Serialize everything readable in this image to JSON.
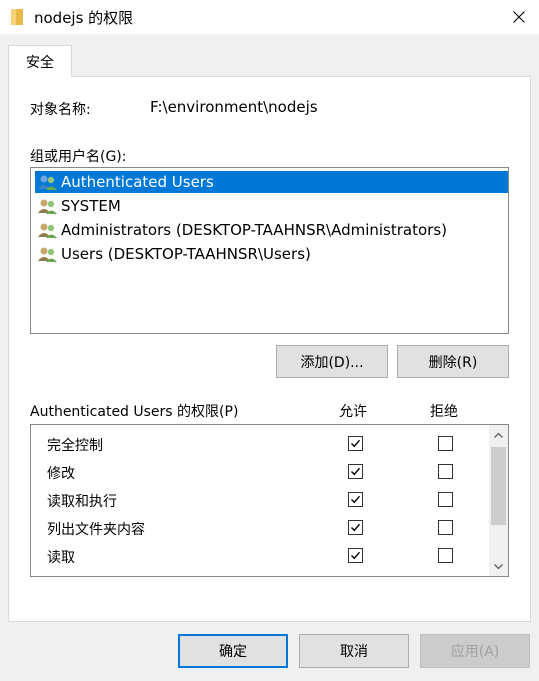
{
  "window": {
    "title": "nodejs 的权限",
    "close_icon": "close-icon"
  },
  "tab": {
    "label": "安全"
  },
  "object": {
    "label": "对象名称:",
    "value": "F:\\environment\\nodejs"
  },
  "groups": {
    "label": "组或用户名(G):",
    "items": [
      {
        "name": "Authenticated Users",
        "selected": true
      },
      {
        "name": "SYSTEM",
        "selected": false
      },
      {
        "name": "Administrators (DESKTOP-TAAHNSR\\Administrators)",
        "selected": false
      },
      {
        "name": "Users (DESKTOP-TAAHNSR\\Users)",
        "selected": false
      }
    ]
  },
  "buttons": {
    "add": "添加(D)...",
    "remove": "删除(R)",
    "ok": "确定",
    "cancel": "取消",
    "apply": "应用(A)"
  },
  "permissions": {
    "label": "Authenticated Users 的权限(P)",
    "allow_header": "允许",
    "deny_header": "拒绝",
    "rows": [
      {
        "name": "完全控制",
        "allow": true,
        "deny": false
      },
      {
        "name": "修改",
        "allow": true,
        "deny": false
      },
      {
        "name": "读取和执行",
        "allow": true,
        "deny": false
      },
      {
        "name": "列出文件夹内容",
        "allow": true,
        "deny": false
      },
      {
        "name": "读取",
        "allow": true,
        "deny": false
      }
    ]
  },
  "colors": {
    "selection": "#0078d7",
    "background": "#f0f0f0"
  }
}
